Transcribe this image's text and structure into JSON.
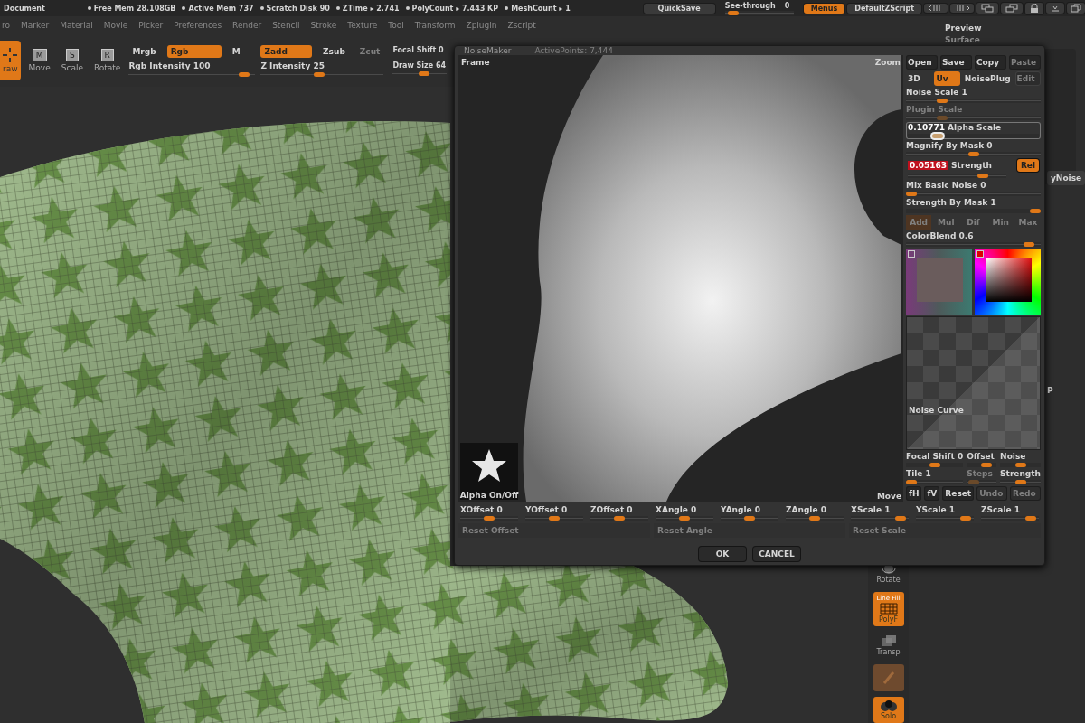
{
  "status_bar": {
    "title": "Document",
    "stats": [
      "Free Mem 28.108GB",
      "Active Mem 737",
      "Scratch Disk 90",
      "ZTime ▸ 2.741",
      "PolyCount ▸ 7.443 KP",
      "MeshCount ▸ 1"
    ]
  },
  "top_controls": {
    "quicksave": "QuickSave",
    "see_through": {
      "label": "See-through",
      "value": "0",
      "level": 0.05
    },
    "menus": {
      "label": "Menus",
      "selected": true
    },
    "script": "DefaultZScript"
  },
  "menu_bar": [
    "ro",
    "Marker",
    "Material",
    "Movie",
    "Picker",
    "Preferences",
    "Render",
    "Stencil",
    "Stroke",
    "Texture",
    "Tool",
    "Transform",
    "Zplugin",
    "Zscript"
  ],
  "toolbar": {
    "tools": [
      {
        "label": "raw",
        "selected": true
      },
      {
        "label": "Move",
        "badge": "M",
        "selected": false
      },
      {
        "label": "Scale",
        "badge": "S",
        "selected": false
      },
      {
        "label": "Rotate",
        "badge": "R",
        "selected": false
      }
    ],
    "color_modes": [
      {
        "label": "Mrgb",
        "selected": false
      },
      {
        "label": "Rgb",
        "selected": true
      },
      {
        "label": "M",
        "selected": false
      }
    ],
    "rgb_intensity": {
      "label": "Rgb Intensity 100",
      "level": 0.95
    },
    "z_modes": [
      {
        "label": "Zadd",
        "selected": true,
        "disabled": false
      },
      {
        "label": "Zsub",
        "selected": false,
        "disabled": false
      },
      {
        "label": "Zcut",
        "selected": false,
        "disabled": true
      }
    ],
    "z_intensity": {
      "label": "Z Intensity 25",
      "level": 0.47
    },
    "focal_shift": "Focal Shift 0",
    "draw_size": {
      "label": "Draw Size 64",
      "level": 0.6
    }
  },
  "right_panel": {
    "title": "Preview",
    "subtitle": "Surface",
    "noise_button": "yNoise",
    "edge_letter": "P"
  },
  "shelf": [
    {
      "kind": "rotate",
      "label": "Rotate",
      "selected": false,
      "disabled": false
    },
    {
      "kind": "grid",
      "caption": "Line Fill",
      "label": "PolyF",
      "selected": true,
      "disabled": false
    },
    {
      "kind": "transp",
      "label": "Transp",
      "selected": false,
      "disabled": false
    },
    {
      "kind": "brush",
      "selected": false,
      "disabled": true
    },
    {
      "kind": "solo",
      "label": "Solo",
      "selected": true,
      "disabled": false
    }
  ],
  "dialog": {
    "title": "NoiseMaker",
    "active_points": "ActivePoints: 7,444",
    "preview": {
      "frame": "Frame",
      "zoom": "Zoom",
      "move": "Move",
      "alpha": "Alpha On/Off"
    },
    "file_buttons": [
      {
        "label": "Open",
        "disabled": false
      },
      {
        "label": "Save",
        "disabled": false
      },
      {
        "label": "Copy",
        "disabled": false
      },
      {
        "label": "Paste",
        "disabled": true
      }
    ],
    "mode_buttons": [
      {
        "label": "3D",
        "selected": false,
        "disabled": false
      },
      {
        "label": "Uv",
        "selected": true,
        "disabled": false
      },
      {
        "label": "NoisePlug",
        "selected": false,
        "disabled": false
      },
      {
        "label": "Edit",
        "selected": false,
        "disabled": true
      }
    ],
    "sliders": [
      {
        "kind": "plain",
        "label": "Noise Scale 1",
        "level": 0.25,
        "disabled": false
      },
      {
        "kind": "plain",
        "label": "Plugin Scale",
        "level": 0.25,
        "disabled": true
      },
      {
        "kind": "editing",
        "value": "0.10771",
        "label": "Alpha Scale",
        "level": 0.2,
        "disabled": false
      },
      {
        "kind": "plain",
        "label": "Magnify By Mask 0",
        "level": 0.5,
        "disabled": false
      },
      {
        "kind": "alert",
        "value": "0.05163",
        "label": "Strength",
        "level": 0.8,
        "disabled": false,
        "toggle": {
          "label": "Rel",
          "on": true
        }
      },
      {
        "kind": "plain",
        "label": "Mix Basic Noise 0",
        "level": 0.0,
        "disabled": false
      },
      {
        "kind": "plain",
        "label": "Strength By Mask 1",
        "level": 1.0,
        "disabled": false
      }
    ],
    "blend_modes": [
      {
        "label": "Add",
        "selected": true
      },
      {
        "label": "Mul",
        "selected": false
      },
      {
        "label": "Dif",
        "selected": false
      },
      {
        "label": "Min",
        "selected": false
      },
      {
        "label": "Max",
        "selected": false
      }
    ],
    "color_blend": {
      "label": "ColorBlend 0.6",
      "level": 0.95
    },
    "noise_curve": "Noise Curve",
    "curve_sliders": [
      {
        "label": "Focal Shift 0",
        "level": 0.5,
        "disabled": false
      },
      {
        "label": "Offset",
        "level": 0.75,
        "disabled": false
      },
      {
        "label": "Noise",
        "level": 0.5,
        "disabled": false
      },
      {
        "label": "Tile 1",
        "level": 0.0,
        "disabled": false
      },
      {
        "label": "Steps",
        "level": 0.1,
        "disabled": true
      },
      {
        "label": "Strength",
        "level": 0.5,
        "disabled": false
      }
    ],
    "curve_buttons": [
      {
        "label": "fH",
        "disabled": false
      },
      {
        "label": "fV",
        "disabled": false
      },
      {
        "label": "Reset",
        "disabled": false
      },
      {
        "label": "Undo",
        "disabled": true
      },
      {
        "label": "Redo",
        "disabled": true
      }
    ],
    "transform_sliders": [
      {
        "label": "XOffset 0",
        "level": 0.5
      },
      {
        "label": "YOffset 0",
        "level": 0.5
      },
      {
        "label": "ZOffset 0",
        "level": 0.5
      },
      {
        "label": "XAngle 0",
        "level": 0.5
      },
      {
        "label": "YAngle 0",
        "level": 0.5
      },
      {
        "label": "ZAngle 0",
        "level": 0.5
      },
      {
        "label": "XScale 1",
        "level": 0.95
      },
      {
        "label": "YScale 1",
        "level": 0.95
      },
      {
        "label": "ZScale 1",
        "level": 0.95
      }
    ],
    "reset_buttons": [
      {
        "label": "Reset Offset",
        "disabled": true
      },
      {
        "label": "Reset Angle",
        "disabled": true
      },
      {
        "label": "Reset Scale",
        "disabled": true
      }
    ],
    "buttons": [
      "OK",
      "CANCEL"
    ]
  }
}
